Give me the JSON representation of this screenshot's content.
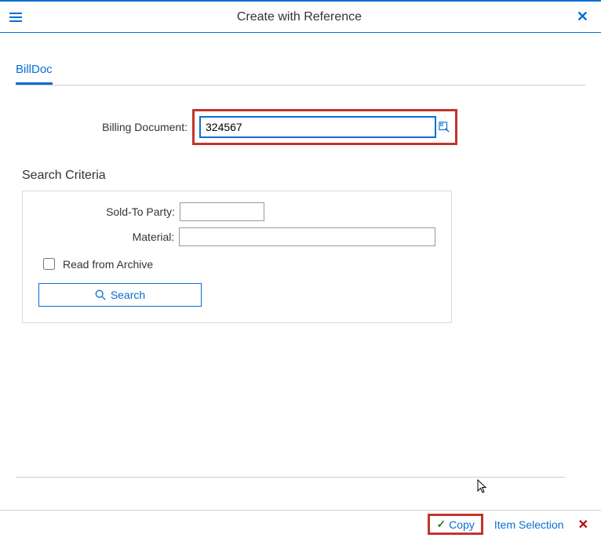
{
  "header": {
    "title": "Create with Reference"
  },
  "tabs": {
    "billdoc": "BillDoc"
  },
  "form": {
    "billing_document_label": "Billing Document:",
    "billing_document_value": "324567"
  },
  "search": {
    "title": "Search Criteria",
    "sold_to_label": "Sold-To Party:",
    "sold_to_value": "",
    "material_label": "Material:",
    "material_value": "",
    "archive_label": "Read from Archive",
    "search_button": "Search"
  },
  "footer": {
    "copy": "Copy",
    "item_selection": "Item Selection"
  }
}
